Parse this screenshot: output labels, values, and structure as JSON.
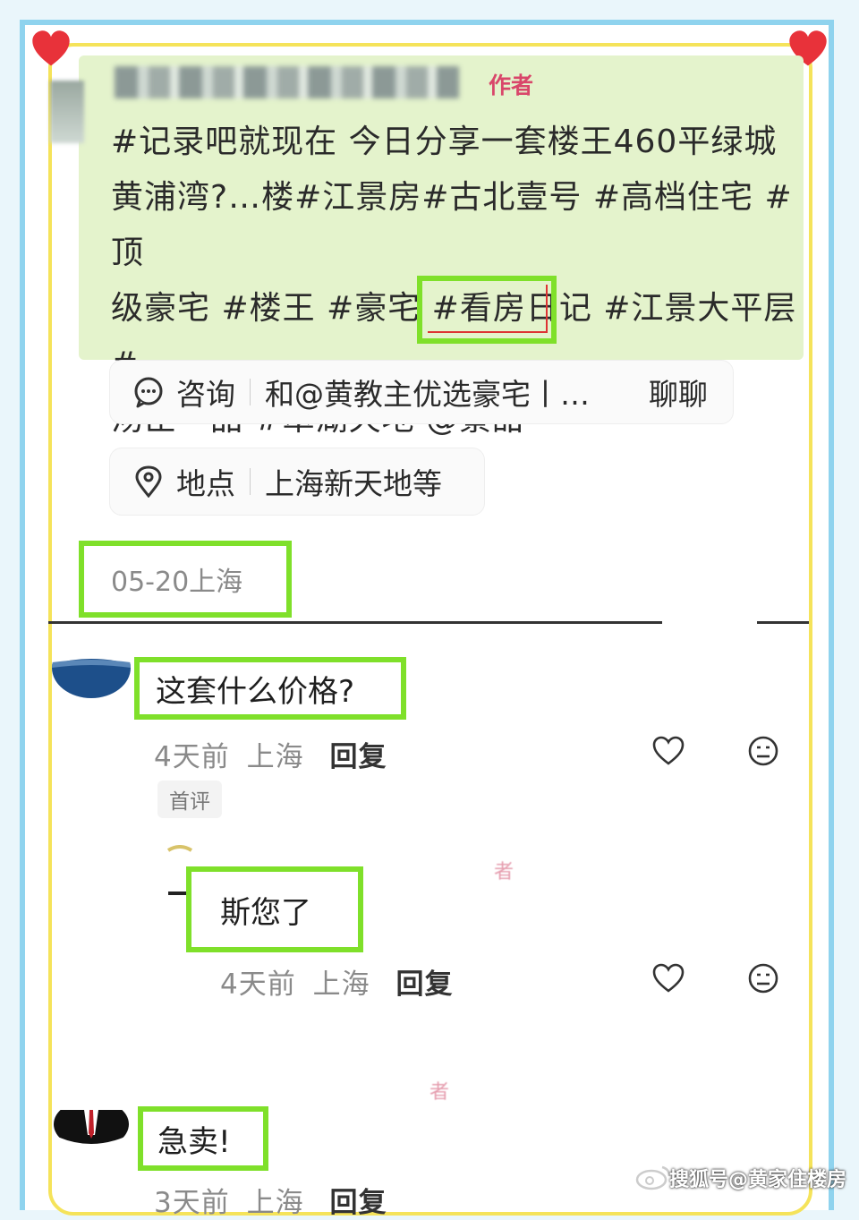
{
  "post": {
    "author_tag": "作者",
    "text_lines": [
      "#记录吧就现在 今日分享一套楼王460平绿城",
      "黄浦湾?…楼#江景房#古北壹号 #高档住宅 #顶",
      "级豪宅 #楼王 #豪宅 #看房日记 #江景大平层 #",
      "汤臣一品 #翠湖天地 @景甜"
    ],
    "consult": {
      "label": "咨询",
      "text": "和@黄教主优选豪宅丨…",
      "action": "聊聊",
      "icon": "chat-bubble-icon"
    },
    "location": {
      "label": "地点",
      "text": "上海新天地等",
      "icon": "location-pin-icon"
    },
    "date": "05-20上海"
  },
  "comments": [
    {
      "text": "这套什么价格?",
      "time": "4天前",
      "place": "上海",
      "reply": "回复",
      "tag": "首评"
    },
    {
      "text": "斯您了",
      "time": "4天前",
      "place": "上海",
      "reply": "回复",
      "faint_tag": "者"
    },
    {
      "text": "急卖!",
      "time": "3天前",
      "place": "上海",
      "reply": "回复",
      "faint_tag": "者"
    }
  ],
  "watermark": "搜狐号@黄家住楼房",
  "colors": {
    "highlight_green": "#7fe02a",
    "frame_yellow": "#f5e35a",
    "frame_blue": "#8fd3ee",
    "post_bg": "#e4f3cc",
    "author_red": "#d9466a",
    "heart_red": "#e8323a"
  }
}
